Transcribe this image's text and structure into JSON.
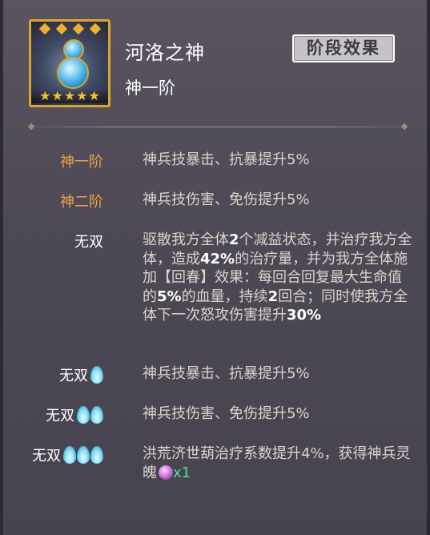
{
  "item": {
    "name": "河洛之神",
    "stage": "神一阶",
    "stars": 5
  },
  "header": {
    "stage_effect_button": "阶段效果"
  },
  "effects": [
    {
      "label": "神一阶",
      "label_color": "#f0a04a",
      "flames": 0,
      "text": "神兵技暴击、抗暴提升5%"
    },
    {
      "label": "神二阶",
      "label_color": "#f0a04a",
      "flames": 0,
      "text": "神兵技伤害、免伤提升5%"
    },
    {
      "label": "无双",
      "label_color": "#ffffff",
      "flames": 0,
      "text_parts": [
        "驱散我方全体",
        "2",
        "个减益状态，并治疗我方全体，造成",
        "42%",
        "的治疗量，并为我方全体施加【回春】效果：每回合回复最大生命值的",
        "5%",
        "的血量，持续",
        "2",
        "回合；同时使我方全体下一次怒攻伤害提升",
        "30%"
      ]
    },
    {
      "label": "无双",
      "label_color": "#ffffff",
      "flames": 1,
      "text": "神兵技暴击、抗暴提升5%"
    },
    {
      "label": "无双",
      "label_color": "#ffffff",
      "flames": 2,
      "text": "神兵技伤害、免伤提升5%"
    },
    {
      "label": "无双",
      "label_color": "#ffffff",
      "flames": 3,
      "text": "洪荒济世葫治疗系数提升4%，获得神兵灵魄",
      "reward_icon": "soul-orb-icon",
      "reward_qty": "x1"
    }
  ]
}
